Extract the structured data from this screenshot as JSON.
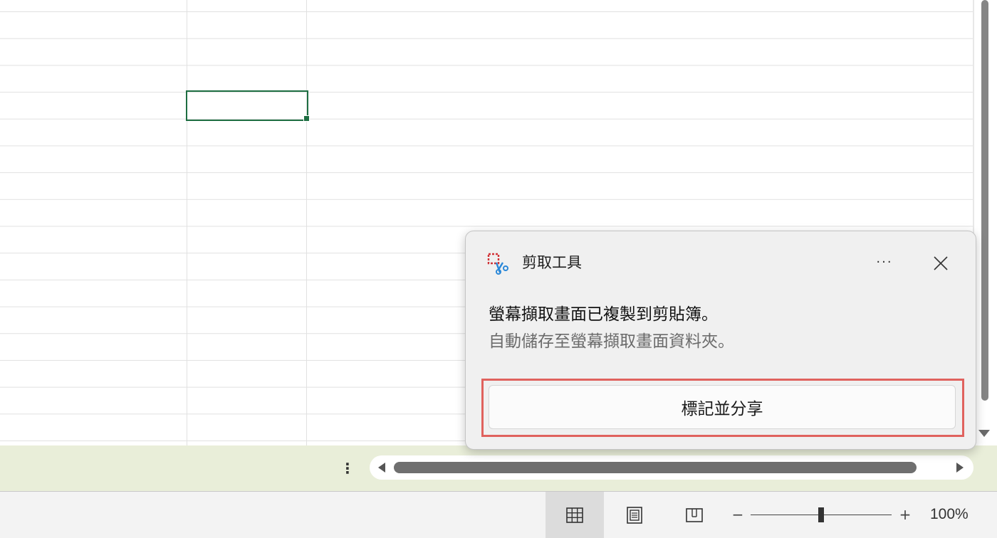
{
  "spreadsheet": {
    "selected_cell": "",
    "accent": "#1e6e42"
  },
  "sheet_tabs": {
    "more_label": "⋮"
  },
  "statusbar": {
    "views": [
      "normal-view-icon",
      "page-layout-view-icon",
      "page-break-preview-icon"
    ],
    "zoom_minus": "−",
    "zoom_plus": "+",
    "zoom_level": "100%"
  },
  "toast": {
    "app_name": "剪取工具",
    "more_label": "···",
    "title": "螢幕擷取畫面已複製到剪貼簿。",
    "body": "自動儲存至螢幕擷取畫面資料夾。",
    "action_label": "標記並分享",
    "highlight_color": "#e0625e"
  }
}
